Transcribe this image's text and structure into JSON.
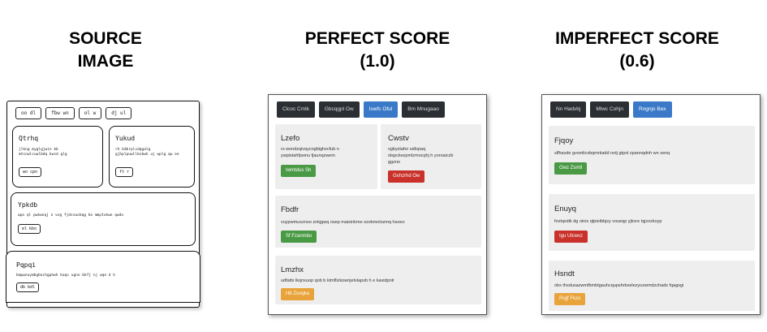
{
  "headings": {
    "source": [
      "SOURCE",
      "IMAGE"
    ],
    "perfect": [
      "PERFECT SCORE",
      "(1.0)"
    ],
    "imperfect": [
      "IMPERFECT SCORE",
      "(0.6)"
    ]
  },
  "sketch": {
    "tabs": [
      "oo dl",
      "fbw wn",
      "ol w",
      "dj ul"
    ],
    "cards": [
      {
        "title": "Qtrhq",
        "text": [
          "jlkng myglgjwin kb",
          "mtcnwlcuwlbdq kwsd glg"
        ],
        "button": "wo cpn"
      },
      {
        "title": "Yukud",
        "text": [
          "rh kdbrplsdqgalg",
          "gjhplpuwllbsbwh uj wplg qw ee"
        ],
        "button": "ft r"
      },
      {
        "title": "Ypkdb",
        "text": [
          "wpo ql pwkwnqj n vog fjdsswsbqg ko mmptxkwe qwdo"
        ],
        "button": "el kbo"
      },
      {
        "title": "Pqpqi",
        "text": [
          "bmpwnuymbgbochgphwh kaqs ugno bkfj nj wqe d h"
        ],
        "button": "db bdl"
      }
    ]
  },
  "perfect": {
    "nav": [
      "Clcoc Cmlk",
      "Gbcqgpl Ow",
      "Iswfc Oful",
      "Bm Mnugaao"
    ],
    "active_index": 2,
    "cards": [
      {
        "title": "Lzefo",
        "text": [
          "rs wondzqivaycogbighxcfub n",
          "ywpistahfpwnu fjaunqzwem"
        ],
        "button": "Iwmtdus Sh",
        "color": "green"
      },
      {
        "title": "Cwstv",
        "text": [
          "vgbyztafor sdlopaq",
          "olspckezpmlzmocqhj h yoroaiczb",
          "ggzno"
        ],
        "button": "Gxhzrhd Ow",
        "color": "red"
      },
      {
        "title": "Fbdfr",
        "text": [
          "vuypwmuxznoo znkjgwq osep maixinkme ozokmolozmq hsoeo"
        ],
        "button": "Sf Fzanmbo",
        "color": "green"
      },
      {
        "title": "Lmzhx",
        "text": [
          "udfattx lkqnxuop qob b ktmflizkownjetvlapxb h e kavidpnlr"
        ],
        "button": "Hb Zoxqka",
        "color": "orange"
      }
    ]
  },
  "imperfect": {
    "nav": [
      "Nn Hadvbj",
      "Mlwc Cohjn",
      "Rngnjo Bex"
    ],
    "active_index": 2,
    "cards": [
      {
        "title": "Fjqoy",
        "text": [
          "slfhavde gvsmlicxbqmrkadd notj gtpxt zpannqdnh wn xenq"
        ],
        "button": "Owz Zsmtl",
        "color": "green"
      },
      {
        "title": "Enuyq",
        "text": [
          "foxtqxidk dg oinix qtpieibbjxy voueqp yjkvre tqjvxzkoyp"
        ],
        "button": "Igu Ulcwvz",
        "color": "red"
      },
      {
        "title": "Hsndt",
        "text": [
          "obx thsdusazwmfbmbtgauhcqupshrbxelezyozwmdzchads fqagsgi"
        ],
        "button": "Rvjjf Fkzo",
        "color": "orange"
      }
    ]
  },
  "colors": {
    "nav_dark": "#2b2f33",
    "nav_active": "#3a79c8",
    "green": "#4a9a45",
    "red": "#c9312a",
    "orange": "#e8a33a"
  }
}
